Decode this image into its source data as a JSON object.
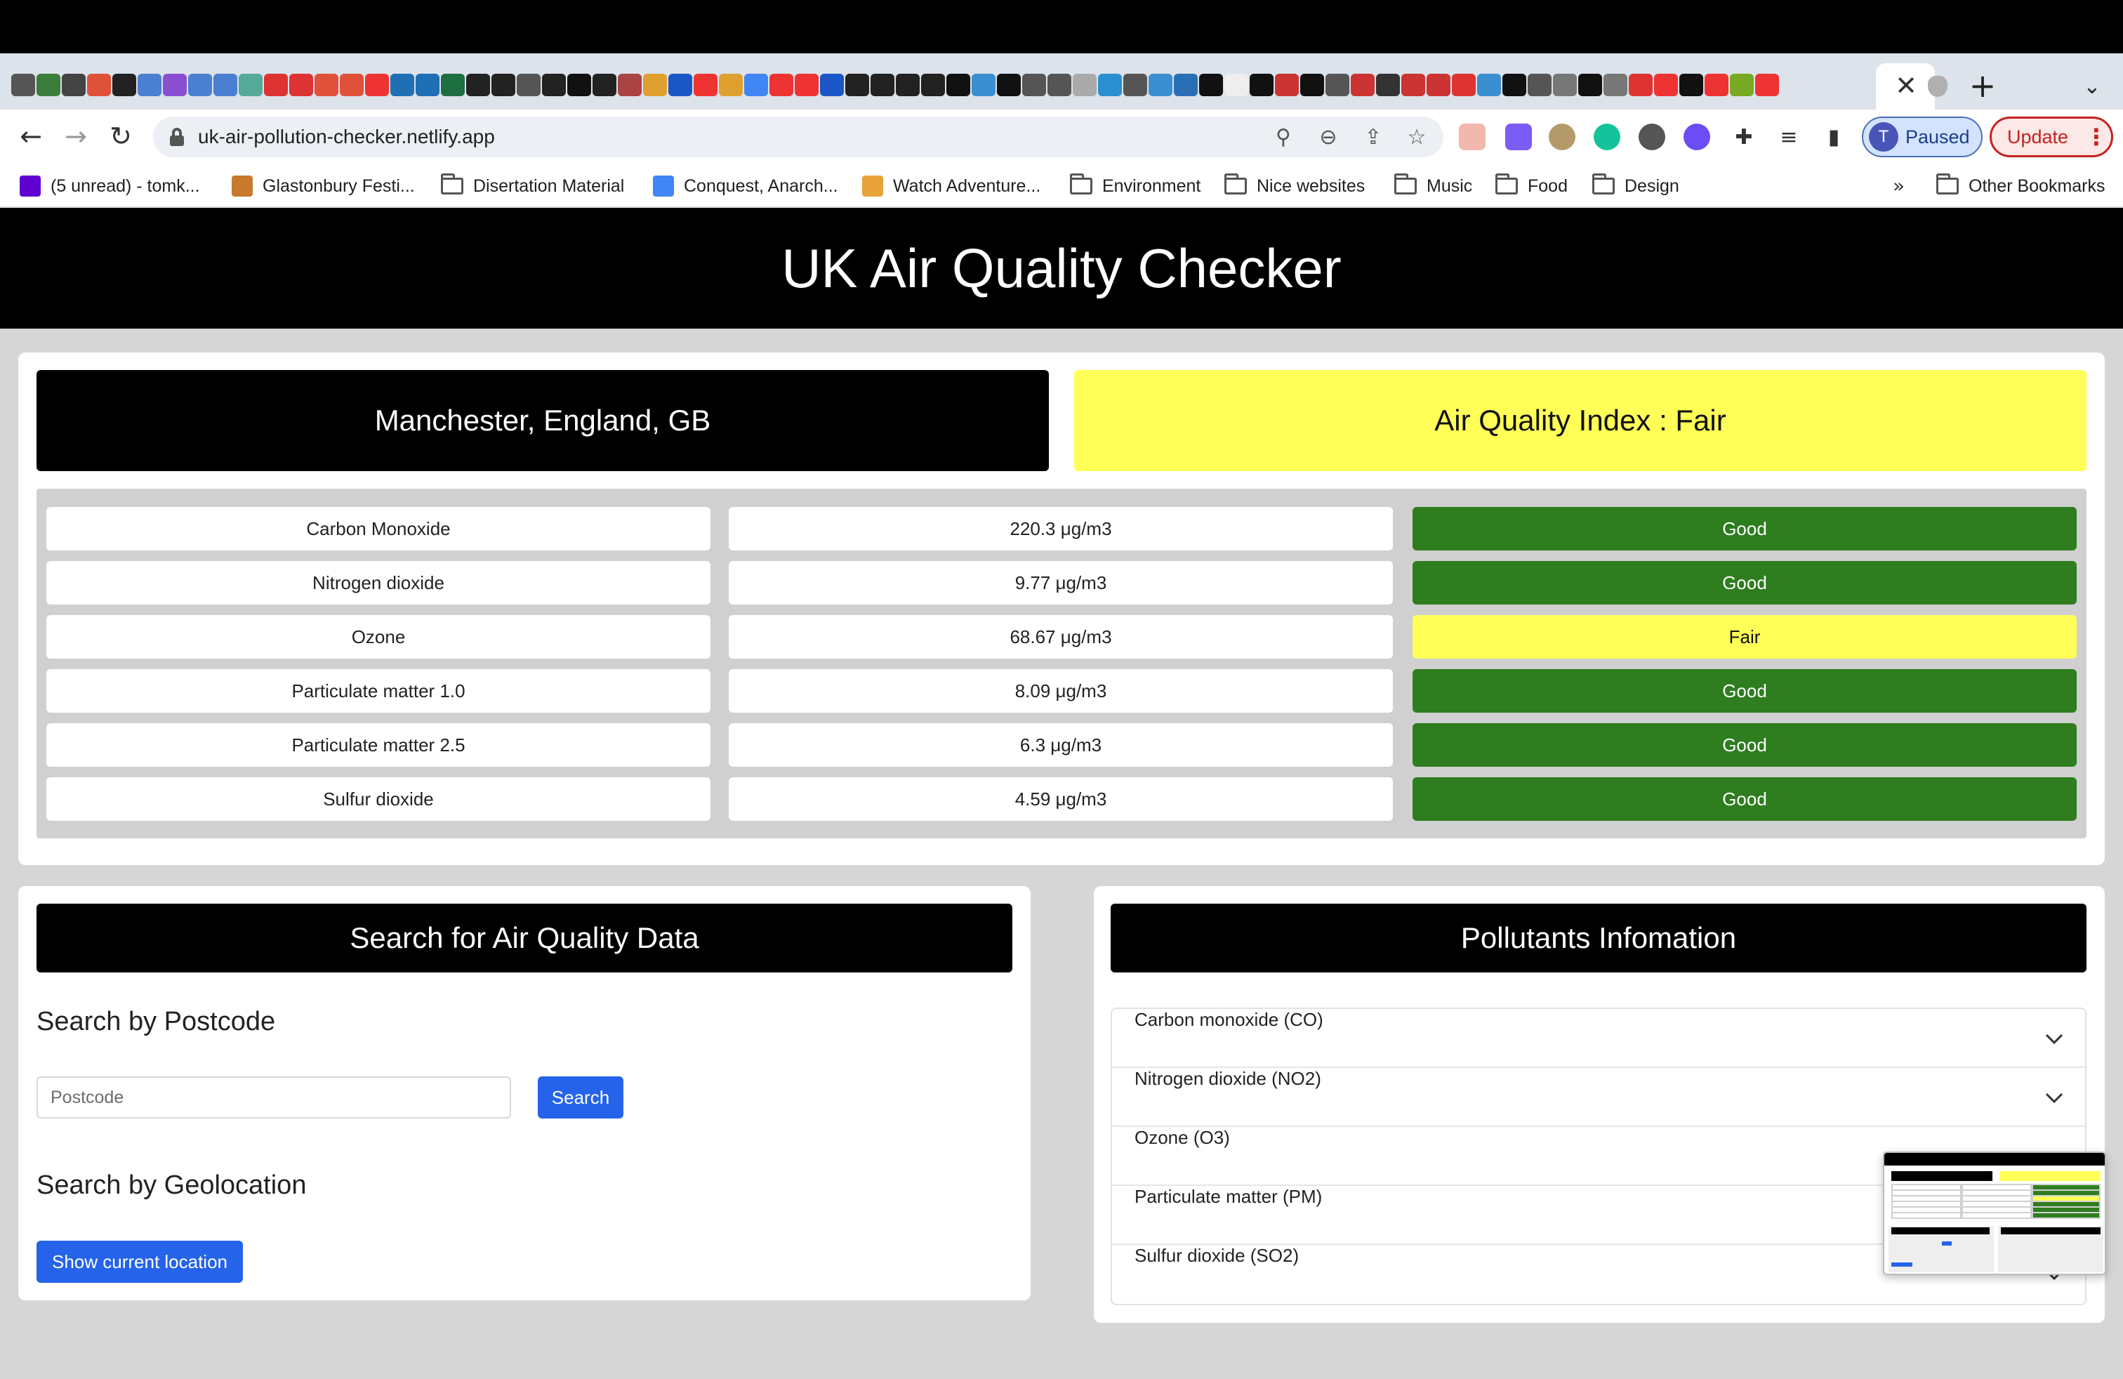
{
  "browser": {
    "url": "uk-air-pollution-checker.netlify.app",
    "profile_initial": "T",
    "profile_status": "Paused",
    "update_label": "Update",
    "tab_favicon_colors": [
      "#555",
      "#3b7d3b",
      "#444",
      "#e0513a",
      "#222",
      "#4a7fd1",
      "#8a4fd1",
      "#4a7fd1",
      "#4a7fd1",
      "#5a9",
      "#d33",
      "#d33",
      "#e0513a",
      "#e0513a",
      "#e33",
      "#1f6fb5",
      "#1f6fb5",
      "#1d6f42",
      "#222",
      "#222",
      "#555",
      "#222",
      "#111",
      "#222",
      "#a44",
      "#e0a030",
      "#1a56c6",
      "#e33",
      "#e0a030",
      "#4285f4",
      "#e33",
      "#e33",
      "#1a56c6",
      "#222",
      "#222",
      "#222",
      "#222",
      "#111",
      "#3b8fd1",
      "#111",
      "#555",
      "#555",
      "#aaa",
      "#2a8fd1",
      "#555",
      "#3b8fd1",
      "#2a6fb5",
      "#111",
      "#eee",
      "#111",
      "#c33",
      "#111",
      "#555",
      "#c33",
      "#333",
      "#c33",
      "#c33",
      "#d33",
      "#3b8fd1",
      "#111",
      "#555",
      "#777",
      "#111",
      "#777",
      "#d33",
      "#e33",
      "#111",
      "#e33",
      "#7a2",
      "#e33"
    ]
  },
  "bookmarks": [
    {
      "label": "(5 unread) - tomk...",
      "icon": "yahoo-icon",
      "color": "#5f01d1"
    },
    {
      "label": "Glastonbury Festi...",
      "icon": "glastonbury-icon",
      "color": "#c77a2c"
    },
    {
      "label": "Disertation Material",
      "icon": "folder-icon"
    },
    {
      "label": "Conquest, Anarch...",
      "icon": "google-icon",
      "color": "#4285f4"
    },
    {
      "label": "Watch Adventure...",
      "icon": "tv-icon",
      "color": "#e8a23a"
    },
    {
      "label": "Environment",
      "icon": "folder-icon"
    },
    {
      "label": "Nice websites",
      "icon": "folder-icon"
    },
    {
      "label": "Music",
      "icon": "folder-icon"
    },
    {
      "label": "Food",
      "icon": "folder-icon"
    },
    {
      "label": "Design",
      "icon": "folder-icon"
    }
  ],
  "bookmarks_more": "»",
  "other_bookmarks": "Other Bookmarks",
  "page": {
    "title": "UK Air Quality Checker",
    "location": "Manchester, England, GB",
    "aqi_label": "Air Quality Index : Fair",
    "aqi_color": "#ffff57",
    "good_color": "#2e7d1f"
  },
  "pollutants": [
    {
      "name": "Carbon Monoxide",
      "value": "220.3 μg/m3",
      "rating": "Good"
    },
    {
      "name": "Nitrogen dioxide",
      "value": "9.77 μg/m3",
      "rating": "Good"
    },
    {
      "name": "Ozone",
      "value": "68.67 μg/m3",
      "rating": "Fair"
    },
    {
      "name": "Particulate matter 1.0",
      "value": "8.09 μg/m3",
      "rating": "Good"
    },
    {
      "name": "Particulate matter 2.5",
      "value": "6.3 μg/m3",
      "rating": "Good"
    },
    {
      "name": "Sulfur dioxide",
      "value": "4.59 μg/m3",
      "rating": "Good"
    }
  ],
  "search": {
    "heading": "Search for Air Quality Data",
    "postcode_heading": "Search by Postcode",
    "postcode_placeholder": "Postcode",
    "search_button": "Search",
    "geo_heading": "Search by Geolocation",
    "geo_button": "Show current location"
  },
  "info": {
    "heading": "Pollutants Infomation",
    "items": [
      "Carbon monoxide (CO)",
      "Nitrogen dioxide (NO2)",
      "Ozone (O3)",
      "Particulate matter (PM)",
      "Sulfur dioxide (SO2)"
    ]
  }
}
